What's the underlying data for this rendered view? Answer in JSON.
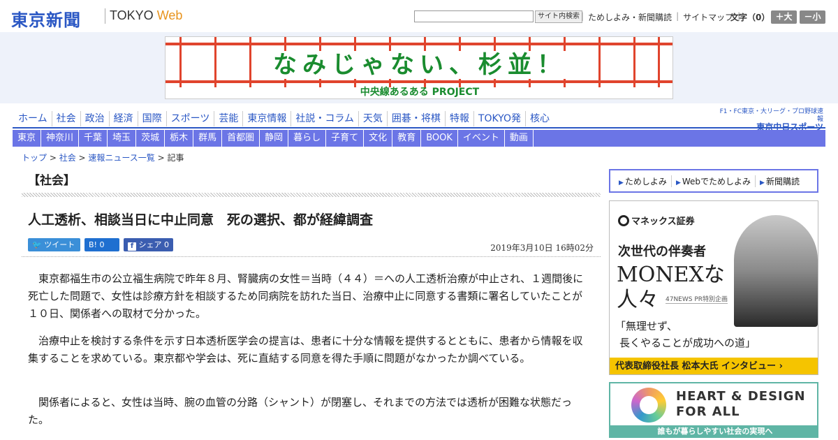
{
  "header": {
    "logo": "東京新聞",
    "logo_sub_prefix": "TOKYO ",
    "logo_sub_web": "Web",
    "search_placeholder": "",
    "search_button": "サイト内検索",
    "links": [
      "ためしよみ・新聞購読",
      "サイトマップ"
    ],
    "font_label": "文字（0）",
    "font_plus": "＋大",
    "font_minus": "－小"
  },
  "banner": {
    "title": "なみじゃない、杉並！",
    "subtitle": "中央線あるある PROJECT"
  },
  "nav_primary": [
    "ホーム",
    "社会",
    "政治",
    "経済",
    "国際",
    "スポーツ",
    "芸能",
    "東京情報",
    "社説・コラム",
    "天気",
    "囲碁・将棋",
    "特報",
    "TOKYO発",
    "核心"
  ],
  "partner": {
    "line1": "F1・FC東京・大リーグ・プロ野球速報",
    "line2": "東京中日スポーツ"
  },
  "nav_secondary": [
    "東京",
    "神奈川",
    "千葉",
    "埼玉",
    "茨城",
    "栃木",
    "群馬",
    "首都圏",
    "静岡",
    "暮らし",
    "子育て",
    "文化",
    "教育",
    "BOOK",
    "イベント",
    "動画"
  ],
  "breadcrumb": {
    "items": [
      "トップ",
      "社会",
      "速報ニュース一覧"
    ],
    "current": "記事",
    "separator": " > "
  },
  "article": {
    "section": "【社会】",
    "headline": "人工透析、相談当日に中止同意　死の選択、都が経緯調査",
    "share_tweet": "ツイート",
    "share_hatena": "B!  0",
    "share_facebook": "シェア 0",
    "date": "2019年3月10日 16時02分",
    "paragraphs": [
      "東京都福生市の公立福生病院で昨年８月、腎臓病の女性＝当時（４４）＝への人工透析治療が中止され、１週間後に死亡した問題で、女性は診療方針を相談するため同病院を訪れた当日、治療中止に同意する書類に署名していたことが１０日、関係者への取材で分かった。",
      "治療中止を検討する条件を示す日本透析医学会の提言は、患者に十分な情報を提供するとともに、患者から情報を収集することを求めている。東京都や学会は、死に直結する同意を得た手順に問題がなかったか調べている。",
      "関係者によると、女性は当時、腕の血管の分路（シャント）が閉塞し、それまでの方法では透析が困難な状態だった。"
    ]
  },
  "sidebar": {
    "links": [
      "ためしよみ",
      "Webでためしよみ",
      "新聞購読"
    ],
    "ad1": {
      "brand": "マネックス証券",
      "line1": "次世代の伴奏者",
      "line2": "MONEXな",
      "line3": "人々",
      "tag": "47NEWS PR特別企画",
      "quote1": "「無理せず、",
      "quote2": "長くやることが成功への道」",
      "cta": "代表取締役社長  松本大氏 インタビュー  ›"
    },
    "ad2": {
      "line1": "HEART & DESIGN",
      "line2": "FOR ALL",
      "caption": "誰もが暮らしやすい社会の実現へ"
    }
  }
}
